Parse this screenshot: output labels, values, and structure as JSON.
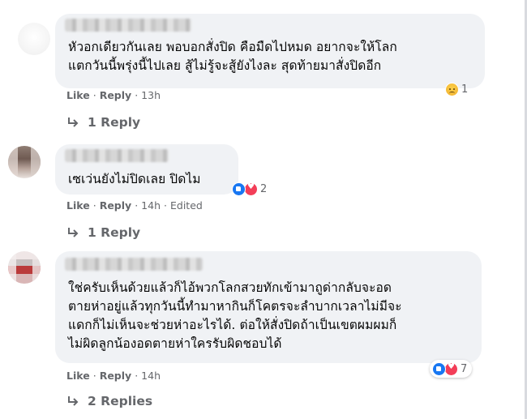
{
  "comments": [
    {
      "text": "หัวอกเดียวกันเลย พอบอกสั่งปิด คือมืดไปหมด อยากจะให้โลก\nแตกวันนี้พรุ่งนี้ไปเลย สู้ไม่รู้จะสู้ยังไงละ สุดท้ายมาสั่งปิดอีก",
      "reaction_icons": [
        "sad-icon"
      ],
      "reaction_count": "1",
      "like": "Like",
      "reply": "Reply",
      "time": "13h",
      "edited": "",
      "replies_label": "1 Reply"
    },
    {
      "text": "เซเว่นยังไม่ปิดเลย ปิดไม",
      "reaction_icons": [
        "like-icon",
        "love-icon"
      ],
      "reaction_count": "2",
      "like": "Like",
      "reply": "Reply",
      "time": "14h",
      "edited": "Edited",
      "replies_label": "1 Reply"
    },
    {
      "text": "ใช่ครับเห็นด้วยแล้วก็ไอ้พวกโลกสวยทักเข้ามาถูด่ากลับจะอด\nตายห่าอยู่แล้วทุกวันนี้ทำมาหากินก็โคตรจะลำบากเวลาไม่มีจะ\nแดกก็ไม่เห็นจะช่วยห่าอะไรได้. ต่อให้สั่งปิดถ้าเป็นเขตผมผมก็\nไม่ผิดลูกน้องอดตายห่าใครรับผิดชอบได้",
      "reaction_icons": [
        "like-icon",
        "love-icon"
      ],
      "reaction_count": "7",
      "like": "Like",
      "reply": "Reply",
      "time": "14h",
      "edited": "",
      "replies_label": "2 Replies"
    }
  ],
  "separator": "·"
}
